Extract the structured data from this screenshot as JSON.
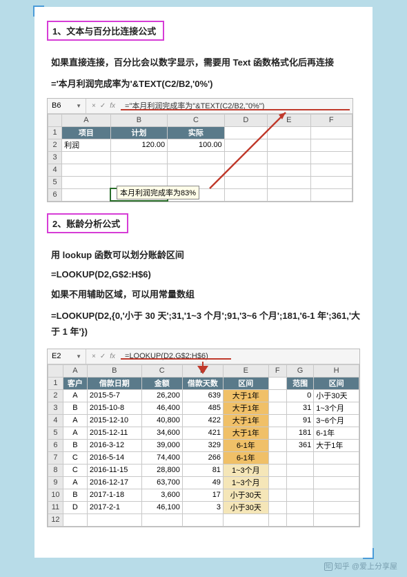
{
  "section1": {
    "heading": "1、文本与百分比连接公式",
    "desc": "如果直接连接，百分比会以数字显示，需要用 Text 函数格式化后再连接",
    "formula": "='本月利润完成率为'&TEXT(C2/B2,'0%')",
    "excel": {
      "name_box": "B6",
      "fx": "=\"本月利润完成率为\"&TEXT(C2/B2,\"0%\")",
      "cols": [
        "A",
        "B",
        "C",
        "D",
        "E",
        "F"
      ],
      "headers": {
        "A": "项目",
        "B": "计划",
        "C": "实际"
      },
      "r2": {
        "A": "利润",
        "B": "120.00",
        "C": "100.00"
      },
      "tooltip": "本月利润完成率为83%"
    }
  },
  "section2": {
    "heading": "2、账龄分析公式",
    "desc1": "用 lookup 函数可以划分账龄区间",
    "formula1": "=LOOKUP(D2,G$2:H$6)",
    "desc2": "如果不用辅助区域，可以用常量数组",
    "formula2": "=LOOKUP(D2,{0,'小于 30 天';31,'1~3 个月';91,'3~6 个月';181,'6-1 年';361,'大于 1 年'})",
    "excel": {
      "name_box": "E2",
      "fx": "=LOOKUP(D2,G$2:H$6)",
      "cols": [
        "A",
        "B",
        "C",
        "D",
        "E",
        "F",
        "G",
        "H"
      ],
      "headers": {
        "A": "客户",
        "B": "借款日期",
        "C": "金额",
        "D": "借款天数",
        "E": "区间",
        "G": "范围",
        "H": "区间"
      },
      "rows": [
        {
          "n": "2",
          "A": "A",
          "B": "2015-5-7",
          "C": "26,200",
          "D": "639",
          "E": "大于1年",
          "G": "0",
          "H": "小于30天"
        },
        {
          "n": "3",
          "A": "B",
          "B": "2015-10-8",
          "C": "46,400",
          "D": "485",
          "E": "大于1年",
          "G": "31",
          "H": "1~3个月"
        },
        {
          "n": "4",
          "A": "A",
          "B": "2015-12-10",
          "C": "40,800",
          "D": "422",
          "E": "大于1年",
          "G": "91",
          "H": "3~6个月"
        },
        {
          "n": "5",
          "A": "A",
          "B": "2015-12-11",
          "C": "34,600",
          "D": "421",
          "E": "大于1年",
          "G": "181",
          "H": "6-1年"
        },
        {
          "n": "6",
          "A": "B",
          "B": "2016-3-12",
          "C": "39,000",
          "D": "329",
          "E": "6-1年",
          "G": "361",
          "H": "大于1年"
        },
        {
          "n": "7",
          "A": "C",
          "B": "2016-5-14",
          "C": "74,400",
          "D": "266",
          "E": "6-1年"
        },
        {
          "n": "8",
          "A": "C",
          "B": "2016-11-15",
          "C": "28,800",
          "D": "81",
          "E": "1~3个月"
        },
        {
          "n": "9",
          "A": "A",
          "B": "2016-12-17",
          "C": "63,700",
          "D": "49",
          "E": "1~3个月"
        },
        {
          "n": "10",
          "A": "B",
          "B": "2017-1-18",
          "C": "3,600",
          "D": "17",
          "E": "小于30天"
        },
        {
          "n": "11",
          "A": "D",
          "B": "2017-2-1",
          "C": "46,100",
          "D": "3",
          "E": "小于30天"
        }
      ]
    }
  },
  "footer": "知乎 @爱上分享屋"
}
